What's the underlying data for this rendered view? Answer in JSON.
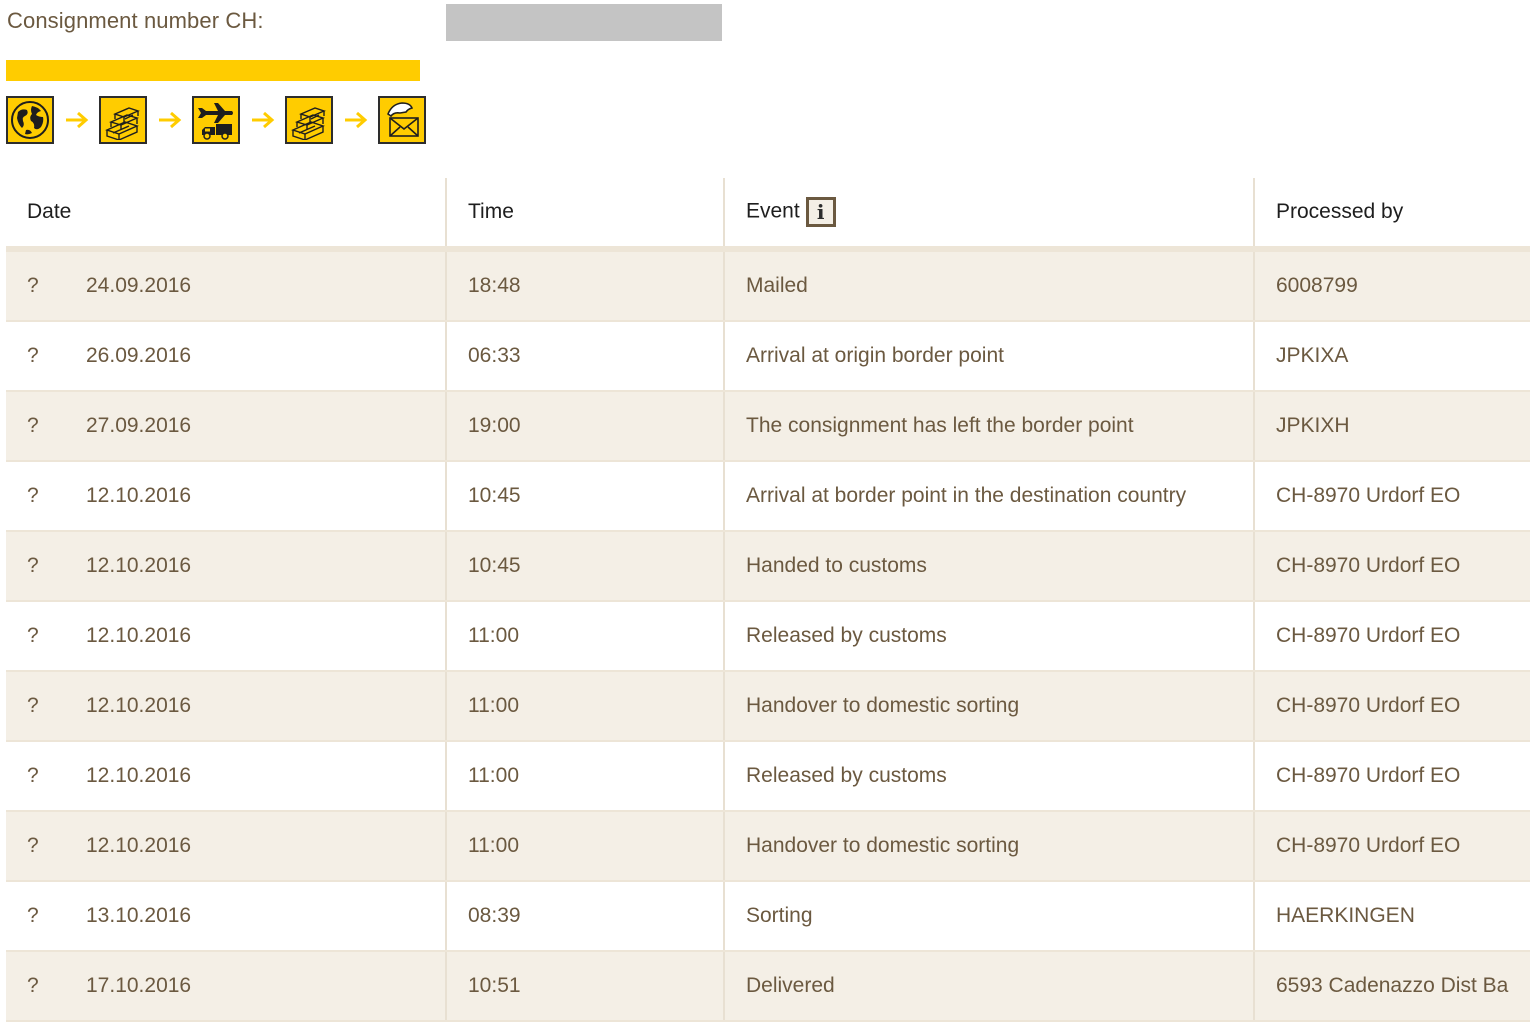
{
  "header": {
    "consignment_label": "Consignment number CH:"
  },
  "progress": {
    "completed_fraction": 1.0
  },
  "status_steps": [
    {
      "icon": "globe-icon"
    },
    {
      "icon": "parcels-icon"
    },
    {
      "icon": "plane-truck-icon"
    },
    {
      "icon": "parcels-icon"
    },
    {
      "icon": "hand-letter-icon"
    }
  ],
  "colors": {
    "accent": "#ffcc00",
    "text": "#6b5940",
    "header_text": "#1e1e1e",
    "row_alt": "#f4efe6",
    "redacted": "#c4c4c4"
  },
  "table": {
    "columns": {
      "date": "Date",
      "time": "Time",
      "event": "Event",
      "event_info": "i",
      "processed_by": "Processed by"
    },
    "rows": [
      {
        "marker": "?",
        "date": "24.09.2016",
        "time": "18:48",
        "event": "Mailed",
        "processed_by": "6008799"
      },
      {
        "marker": "?",
        "date": "26.09.2016",
        "time": "06:33",
        "event": "Arrival at origin border point",
        "processed_by": "JPKIXA"
      },
      {
        "marker": "?",
        "date": "27.09.2016",
        "time": "19:00",
        "event": "The consignment has left the border point",
        "processed_by": "JPKIXH"
      },
      {
        "marker": "?",
        "date": "12.10.2016",
        "time": "10:45",
        "event": "Arrival at border point in the destination country",
        "processed_by": "CH-8970 Urdorf EO"
      },
      {
        "marker": "?",
        "date": "12.10.2016",
        "time": "10:45",
        "event": "Handed to customs",
        "processed_by": "CH-8970 Urdorf EO"
      },
      {
        "marker": "?",
        "date": "12.10.2016",
        "time": "11:00",
        "event": "Released by customs",
        "processed_by": "CH-8970 Urdorf EO"
      },
      {
        "marker": "?",
        "date": "12.10.2016",
        "time": "11:00",
        "event": "Handover to domestic sorting",
        "processed_by": "CH-8970 Urdorf EO"
      },
      {
        "marker": "?",
        "date": "12.10.2016",
        "time": "11:00",
        "event": "Released by customs",
        "processed_by": "CH-8970 Urdorf EO"
      },
      {
        "marker": "?",
        "date": "12.10.2016",
        "time": "11:00",
        "event": "Handover to domestic sorting",
        "processed_by": "CH-8970 Urdorf EO"
      },
      {
        "marker": "?",
        "date": "13.10.2016",
        "time": "08:39",
        "event": "Sorting",
        "processed_by": "HAERKINGEN"
      },
      {
        "marker": "?",
        "date": "17.10.2016",
        "time": "10:51",
        "event": "Delivered",
        "processed_by": "6593 Cadenazzo Dist Ba"
      }
    ]
  }
}
